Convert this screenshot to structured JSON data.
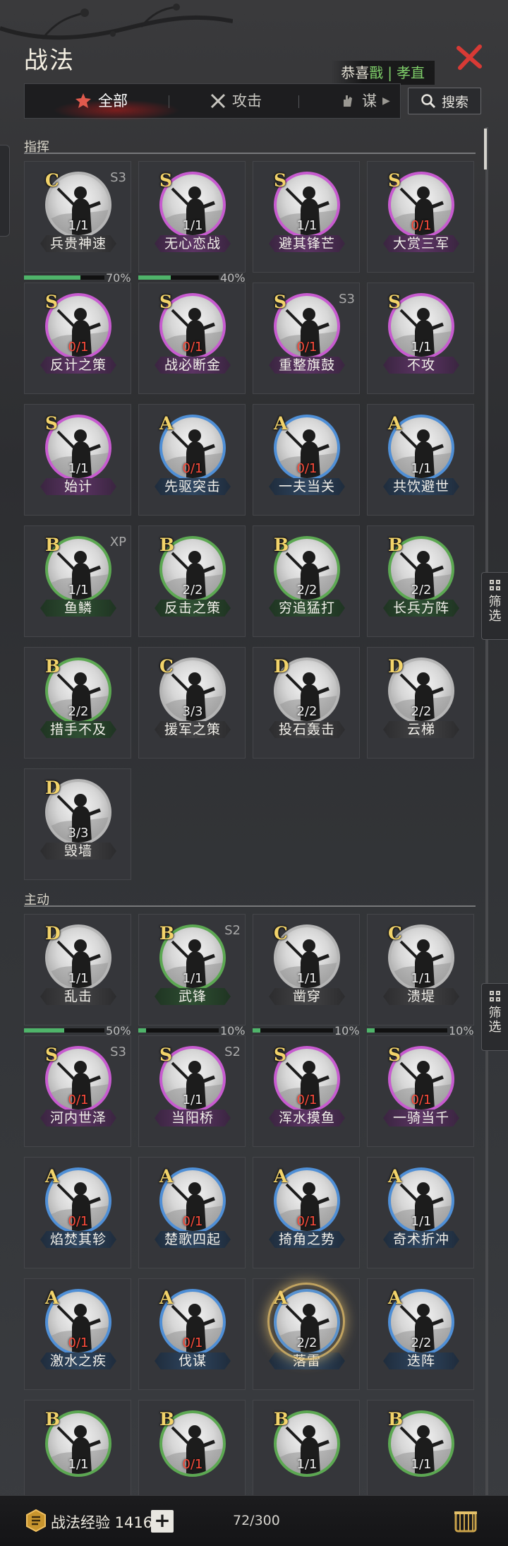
{
  "header": {
    "title": "战法",
    "congrats_prefix": "恭喜",
    "congrats_emphasis": "戬",
    "congrats_separator": "|",
    "congrats_name": "孝直"
  },
  "tabs": {
    "all": "全部",
    "attack": "攻击",
    "strategy": "谋",
    "search": "搜索"
  },
  "sections": {
    "command": "指挥",
    "active": "主动"
  },
  "filter": {
    "label_1": "筛",
    "label_2": "选"
  },
  "command_cards": [
    {
      "grade": "C",
      "badge": "S3",
      "count": "1/1",
      "name": "兵贵神速",
      "rarity": "C",
      "progress": 0.7,
      "progress_label": "70%"
    },
    {
      "grade": "S",
      "badge": "",
      "count": "1/1",
      "name": "无心恋战",
      "rarity": "S",
      "progress": 0.4,
      "progress_label": "40%"
    },
    {
      "grade": "S",
      "badge": "",
      "count": "1/1",
      "name": "避其锋芒",
      "rarity": "S"
    },
    {
      "grade": "S",
      "badge": "",
      "count": "0/1",
      "name": "大赏三军",
      "rarity": "S"
    },
    {
      "grade": "S",
      "badge": "",
      "count": "0/1",
      "name": "反计之策",
      "rarity": "S"
    },
    {
      "grade": "S",
      "badge": "",
      "count": "0/1",
      "name": "战必断金",
      "rarity": "S"
    },
    {
      "grade": "S",
      "badge": "S3",
      "count": "0/1",
      "name": "重整旗鼓",
      "rarity": "S"
    },
    {
      "grade": "S",
      "badge": "",
      "count": "1/1",
      "name": "不攻",
      "rarity": "S"
    },
    {
      "grade": "S",
      "badge": "",
      "count": "1/1",
      "name": "始计",
      "rarity": "S"
    },
    {
      "grade": "A",
      "badge": "",
      "count": "0/1",
      "name": "先驱突击",
      "rarity": "A"
    },
    {
      "grade": "A",
      "badge": "",
      "count": "0/1",
      "name": "一夫当关",
      "rarity": "A"
    },
    {
      "grade": "A",
      "badge": "",
      "count": "1/1",
      "name": "共饮避世",
      "rarity": "A"
    },
    {
      "grade": "B",
      "badge": "XP",
      "count": "1/1",
      "name": "鱼鳞",
      "rarity": "B"
    },
    {
      "grade": "B",
      "badge": "",
      "count": "2/2",
      "name": "反击之策",
      "rarity": "B"
    },
    {
      "grade": "B",
      "badge": "",
      "count": "2/2",
      "name": "穷追猛打",
      "rarity": "B"
    },
    {
      "grade": "B",
      "badge": "",
      "count": "2/2",
      "name": "长兵方阵",
      "rarity": "B"
    },
    {
      "grade": "B",
      "badge": "",
      "count": "2/2",
      "name": "措手不及",
      "rarity": "B"
    },
    {
      "grade": "C",
      "badge": "",
      "count": "3/3",
      "name": "援军之策",
      "rarity": "C"
    },
    {
      "grade": "D",
      "badge": "",
      "count": "2/2",
      "name": "投石轰击",
      "rarity": "D"
    },
    {
      "grade": "D",
      "badge": "",
      "count": "2/2",
      "name": "云梯",
      "rarity": "D"
    },
    {
      "grade": "D",
      "badge": "",
      "count": "3/3",
      "name": "毁墙",
      "rarity": "D"
    }
  ],
  "active_cards": [
    {
      "grade": "D",
      "badge": "",
      "count": "1/1",
      "name": "乱击",
      "rarity": "D",
      "progress": 0.5,
      "progress_label": "50%"
    },
    {
      "grade": "B",
      "badge": "S2",
      "count": "1/1",
      "name": "武锋",
      "rarity": "B",
      "progress": 0.1,
      "progress_label": "10%"
    },
    {
      "grade": "C",
      "badge": "",
      "count": "1/1",
      "name": "凿穿",
      "rarity": "C",
      "progress": 0.1,
      "progress_label": "10%"
    },
    {
      "grade": "C",
      "badge": "",
      "count": "1/1",
      "name": "溃堤",
      "rarity": "C",
      "progress": 0.1,
      "progress_label": "10%"
    },
    {
      "grade": "S",
      "badge": "S3",
      "count": "0/1",
      "name": "河内世泽",
      "rarity": "S"
    },
    {
      "grade": "S",
      "badge": "S2",
      "count": "1/1",
      "name": "当阳桥",
      "rarity": "S"
    },
    {
      "grade": "S",
      "badge": "",
      "count": "0/1",
      "name": "浑水摸鱼",
      "rarity": "S"
    },
    {
      "grade": "S",
      "badge": "",
      "count": "0/1",
      "name": "一骑当千",
      "rarity": "S"
    },
    {
      "grade": "A",
      "badge": "",
      "count": "0/1",
      "name": "焰焚其轸",
      "rarity": "A"
    },
    {
      "grade": "A",
      "badge": "",
      "count": "0/1",
      "name": "楚歌四起",
      "rarity": "A"
    },
    {
      "grade": "A",
      "badge": "",
      "count": "0/1",
      "name": "掎角之势",
      "rarity": "A"
    },
    {
      "grade": "A",
      "badge": "",
      "count": "1/1",
      "name": "奇术折冲",
      "rarity": "A"
    },
    {
      "grade": "A",
      "badge": "",
      "count": "0/1",
      "name": "激水之疾",
      "rarity": "A"
    },
    {
      "grade": "A",
      "badge": "",
      "count": "0/1",
      "name": "伐谋",
      "rarity": "A"
    },
    {
      "grade": "A",
      "badge": "",
      "count": "2/2",
      "name": "落雷",
      "rarity": "A",
      "highlight": true
    },
    {
      "grade": "A",
      "badge": "",
      "count": "2/2",
      "name": "迭阵",
      "rarity": "A"
    },
    {
      "grade": "B",
      "badge": "",
      "count": "1/1",
      "name": "",
      "rarity": "B"
    },
    {
      "grade": "B",
      "badge": "",
      "count": "0/1",
      "name": "",
      "rarity": "B"
    },
    {
      "grade": "B",
      "badge": "",
      "count": "1/1",
      "name": "",
      "rarity": "B"
    },
    {
      "grade": "B",
      "badge": "",
      "count": "1/1",
      "name": "",
      "rarity": "B"
    }
  ],
  "footer": {
    "exp_label": "战法经验 1416",
    "plus": "+",
    "capacity": "72/300"
  },
  "colors": {
    "S": "#c75bcf",
    "A": "#4f8fd6",
    "B": "#5ca852",
    "C": "#b5b5b5",
    "D": "#b5b5b5",
    "grade_text": "#f2d36a",
    "zero_count": "#ff4b3a",
    "accent_red": "#d83a35",
    "progress": "#4fb46a"
  },
  "icons": [
    "close-icon",
    "all-tab-icon",
    "attack-swords-icon",
    "strategy-hand-icon",
    "search-icon",
    "filter-grid-icon",
    "exp-scroll-icon",
    "bag-icon",
    "general-portrait-icon"
  ]
}
